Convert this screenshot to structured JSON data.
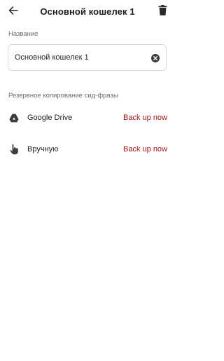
{
  "header": {
    "title": "Основной кошелек 1",
    "back_icon": "arrow-left-icon",
    "delete_icon": "trash-icon"
  },
  "name_field": {
    "label": "Название",
    "value": "Основной кошелек 1",
    "clear_icon": "clear-circle-icon"
  },
  "backup": {
    "section_label": "Резервное копирование сид-фразы",
    "items": [
      {
        "icon": "google-drive-icon",
        "label": "Google Drive",
        "action": "Back up now"
      },
      {
        "icon": "hand-pointer-icon",
        "label": "Вручную",
        "action": "Back up now"
      }
    ]
  },
  "colors": {
    "action": "#a4161a",
    "text": "#1f1f1f",
    "muted": "#6b6b6b",
    "border": "#d9d9d9",
    "icon": "#3d3d3d"
  }
}
